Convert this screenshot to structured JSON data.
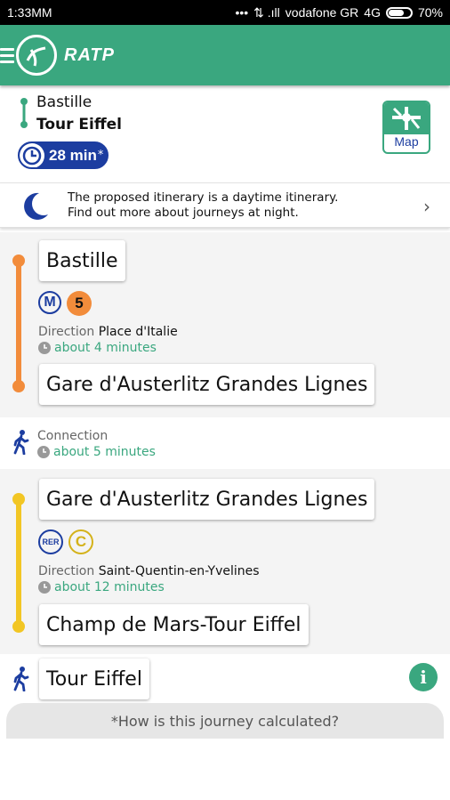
{
  "status_bar": {
    "time": "1:33MM",
    "carrier": "vodafone GR",
    "network": "4G",
    "battery": "70%",
    "battery_level": 0.7
  },
  "app_bar": {
    "brand": "RATP"
  },
  "summary": {
    "from": "Bastille",
    "to": "Tour Eiffel",
    "duration": "28 min",
    "duration_mark": "*",
    "map_label": "Map"
  },
  "night_notice": {
    "line1": "The proposed itinerary is a daytime itinerary.",
    "line2": "Find out more about journeys at night."
  },
  "legs": [
    {
      "line_color": "#f28c3b",
      "mode": "M",
      "line": "5",
      "from": "Bastille",
      "direction_label": "Direction",
      "direction": "Place d'Italie",
      "time": "about 4 minutes",
      "to": "Gare d'Austerlitz Grandes Lignes"
    },
    {
      "line_color": "#f2c624",
      "mode": "RER",
      "line": "C",
      "from": "Gare d'Austerlitz Grandes Lignes",
      "direction_label": "Direction",
      "direction": "Saint-Quentin-en-Yvelines",
      "time": "about 12 minutes",
      "to": "Champ de Mars-Tour Eiffel"
    }
  ],
  "connection": {
    "label": "Connection",
    "time": "about 5 minutes"
  },
  "destination": "Tour Eiffel",
  "info_icon": "i",
  "how_calculated": "*How is this journey calculated?",
  "colors": {
    "brand_green": "#3aa77f",
    "navy": "#1c3da0",
    "metro5": "#f28c3b",
    "rer_c": "#f2c624"
  }
}
